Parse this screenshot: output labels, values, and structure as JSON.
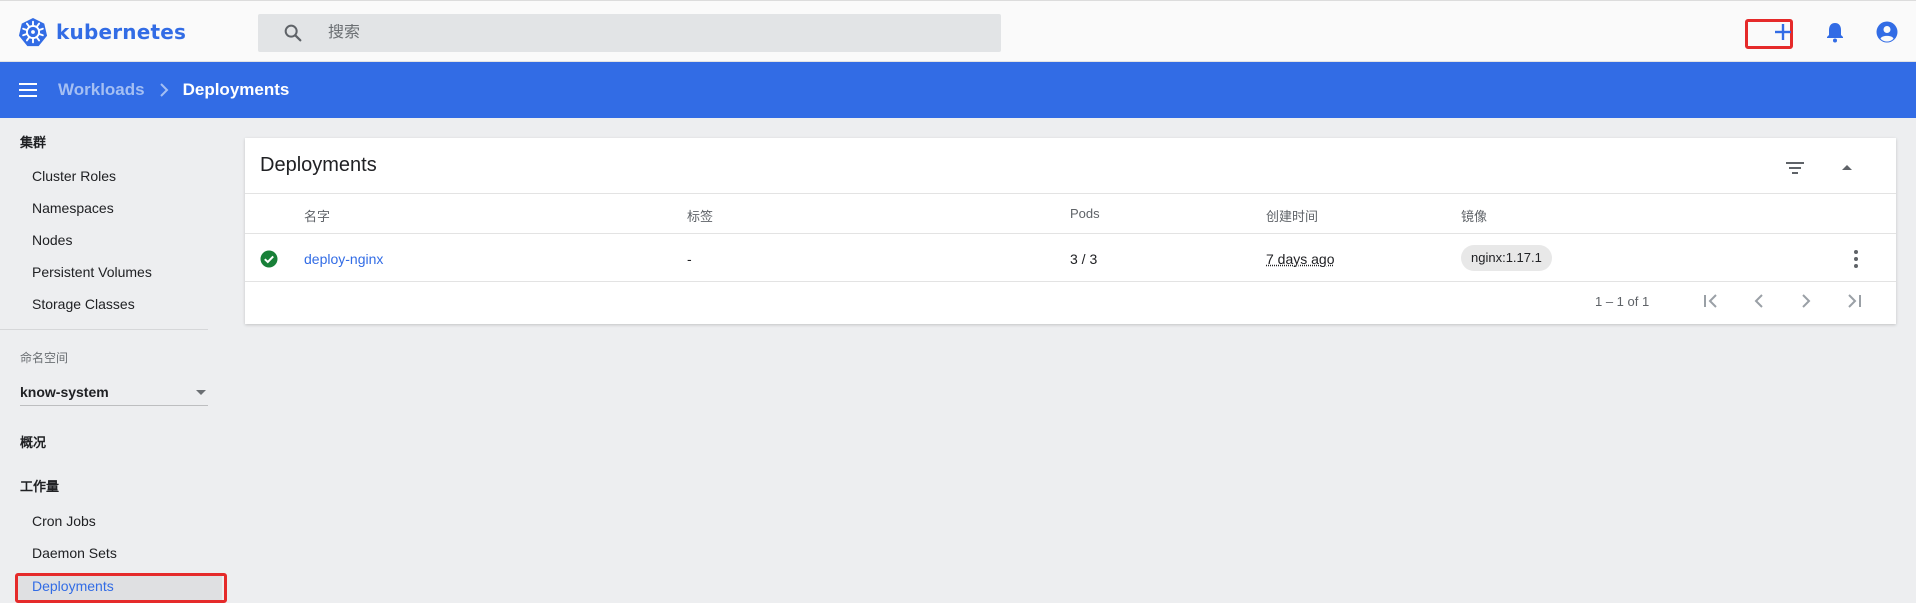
{
  "app": {
    "name": "kubernetes"
  },
  "search": {
    "placeholder": "搜索"
  },
  "breadcrumb": {
    "parent": "Workloads",
    "current": "Deployments"
  },
  "sidebar": {
    "cluster_title": "集群",
    "cluster_items": [
      "Cluster Roles",
      "Namespaces",
      "Nodes",
      "Persistent Volumes",
      "Storage Classes"
    ],
    "namespace_label": "命名空间",
    "namespace_value": "know-system",
    "overview": "概况",
    "workloads_title": "工作量",
    "workload_items": [
      "Cron Jobs",
      "Daemon Sets",
      "Deployments"
    ],
    "active_item": "Deployments"
  },
  "card": {
    "title": "Deployments",
    "columns": [
      "名字",
      "标签",
      "Pods",
      "创建时间",
      "镜像"
    ],
    "rows": [
      {
        "status": "success",
        "name": "deploy-nginx",
        "labels": "-",
        "pods": "3 / 3",
        "created": "7 days ago",
        "image": "nginx:1.17.1"
      }
    ],
    "pagination": "1 – 1 of 1"
  },
  "colors": {
    "brand": "#326ce5",
    "highlight": "#e52a2a",
    "success": "#188038"
  },
  "icons": [
    "kubernetes-logo",
    "search-icon",
    "plus-icon",
    "bell-icon",
    "account-icon",
    "menu-icon",
    "chevron-right-icon",
    "filter-icon",
    "collapse-icon",
    "check-circle-icon",
    "more-vert-icon",
    "first-page-icon",
    "prev-page-icon",
    "next-page-icon",
    "last-page-icon"
  ]
}
